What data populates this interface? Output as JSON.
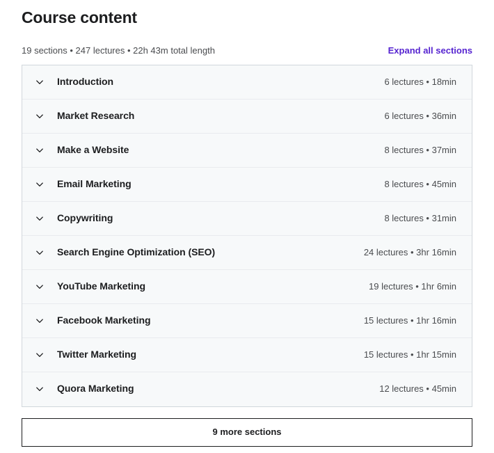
{
  "header": {
    "title": "Course content",
    "course_meta": "19 sections • 247 lectures • 22h 43m total length",
    "expand_all_label": "Expand all sections",
    "accent_color": "#5624d0"
  },
  "sections": [
    {
      "title": "Introduction",
      "meta": "6 lectures • 18min",
      "icon": "chevron-down-icon"
    },
    {
      "title": "Market Research",
      "meta": "6 lectures • 36min",
      "icon": "chevron-down-icon"
    },
    {
      "title": "Make a Website",
      "meta": "8 lectures • 37min",
      "icon": "chevron-down-icon"
    },
    {
      "title": "Email Marketing",
      "meta": "8 lectures • 45min",
      "icon": "chevron-down-icon"
    },
    {
      "title": "Copywriting",
      "meta": "8 lectures • 31min",
      "icon": "chevron-down-icon"
    },
    {
      "title": "Search Engine Optimization (SEO)",
      "meta": "24 lectures • 3hr 16min",
      "icon": "chevron-down-icon"
    },
    {
      "title": "YouTube Marketing",
      "meta": "19 lectures • 1hr 6min",
      "icon": "chevron-down-icon"
    },
    {
      "title": "Facebook Marketing",
      "meta": "15 lectures • 1hr 16min",
      "icon": "chevron-down-icon"
    },
    {
      "title": "Twitter Marketing",
      "meta": "15 lectures • 1hr 15min",
      "icon": "chevron-down-icon"
    },
    {
      "title": "Quora Marketing",
      "meta": "12 lectures • 45min",
      "icon": "chevron-down-icon"
    }
  ],
  "footer": {
    "more_sections_label": "9 more sections"
  }
}
